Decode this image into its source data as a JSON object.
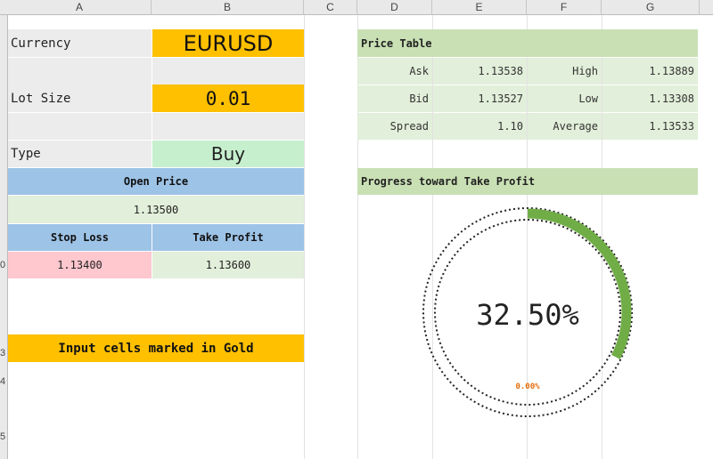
{
  "columns": [
    "A",
    "B",
    "C",
    "D",
    "E",
    "F",
    "G"
  ],
  "row_header_fragments": [
    "0",
    "3",
    "4",
    "5"
  ],
  "inputs": {
    "currency_label": "Currency",
    "currency_value": "EURUSD",
    "lot_size_label": "Lot Size",
    "lot_size_value": "0.01",
    "type_label": "Type",
    "type_value": "Buy"
  },
  "prices": {
    "open_price_label": "Open Price",
    "open_price_value": "1.13500",
    "stop_loss_label": "Stop Loss",
    "take_profit_label": "Take Profit",
    "stop_loss_value": "1.13400",
    "take_profit_value": "1.13600"
  },
  "note": "Input cells marked in Gold",
  "price_table": {
    "title": "Price Table",
    "rows": [
      {
        "l1": "Ask",
        "v1": "1.13538",
        "l2": "High",
        "v2": "1.13889"
      },
      {
        "l1": "Bid",
        "v1": "1.13527",
        "l2": "Low",
        "v2": "1.13308"
      },
      {
        "l1": "Spread",
        "v1": "1.10",
        "l2": "Average",
        "v2": "1.13533"
      }
    ]
  },
  "progress": {
    "title": "Progress toward Take Profit",
    "value_text": "32.50%",
    "value": 0.325,
    "small_label": "0.00%",
    "arc_color": "#70ad47",
    "small_label_color": "#e46c0a"
  },
  "colors": {
    "gold": "#ffc000",
    "blue_header": "#9dc3e6",
    "green_header": "#c9e0b4",
    "pale_green": "#e2efda",
    "pink": "#ffc7ce"
  }
}
